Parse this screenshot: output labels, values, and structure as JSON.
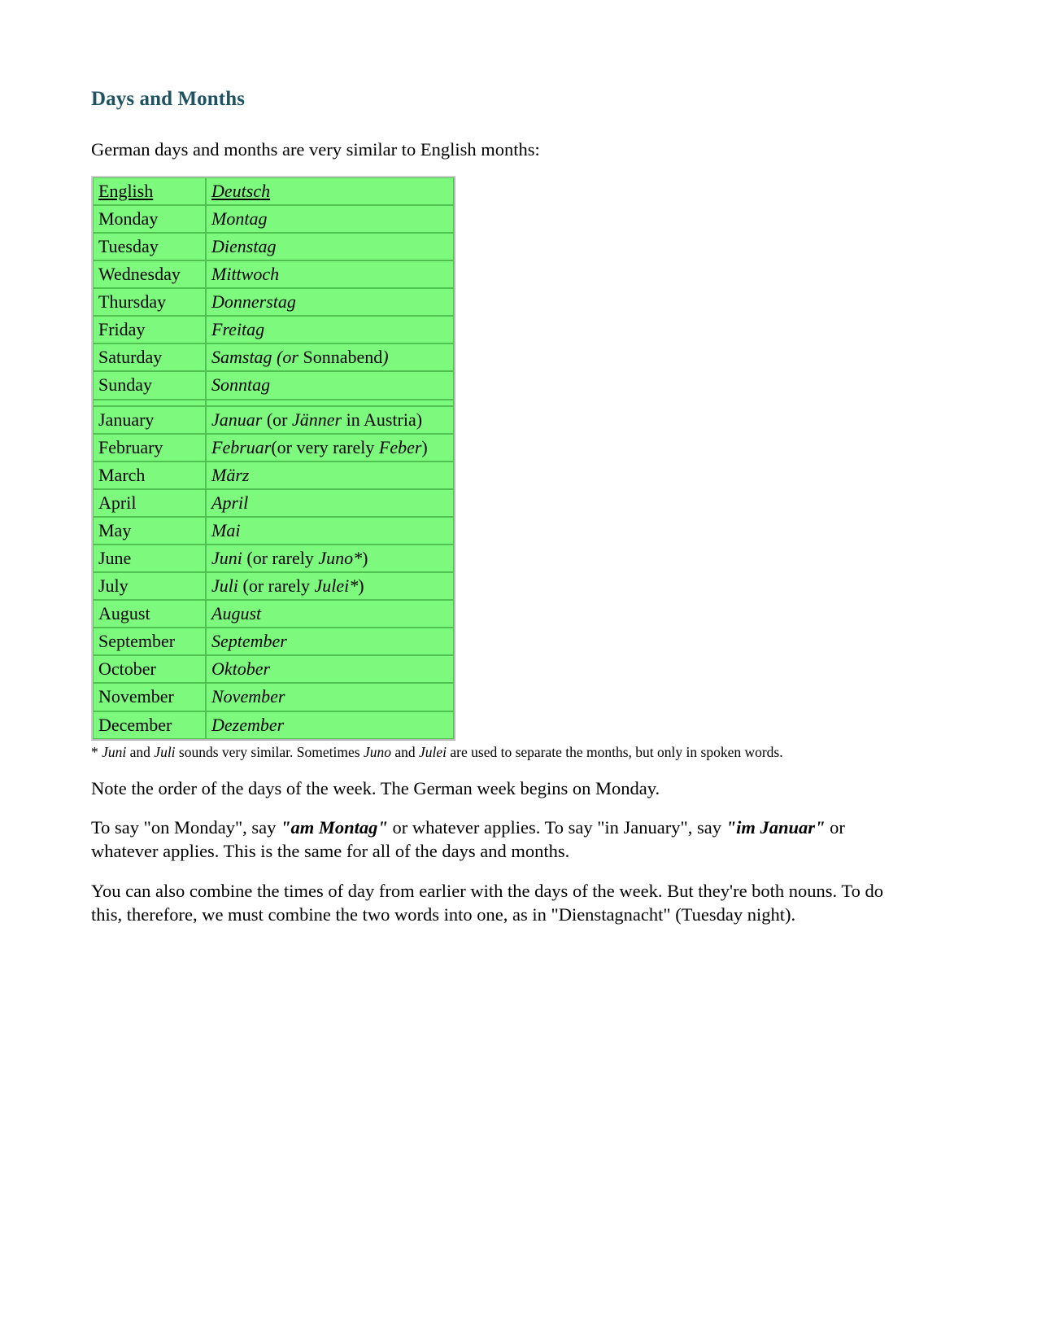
{
  "document": {
    "title": "Days and Months",
    "intro": "German days and months are very similar to English months:"
  },
  "table": {
    "headers": {
      "english": "English",
      "deutsch": "Deutsch"
    },
    "days": [
      {
        "english": "Monday",
        "de_main": "Montag",
        "de_mid": "",
        "de_tail": "",
        "de_end": ""
      },
      {
        "english": "Tuesday",
        "de_main": "Dienstag",
        "de_mid": "",
        "de_tail": "",
        "de_end": ""
      },
      {
        "english": "Wednesday",
        "de_main": "Mittwoch",
        "de_mid": "",
        "de_tail": "",
        "de_end": ""
      },
      {
        "english": "Thursday",
        "de_main": "Donnerstag",
        "de_mid": "",
        "de_tail": "",
        "de_end": ""
      },
      {
        "english": "Friday",
        "de_main": "Freitag",
        "de_mid": "",
        "de_tail": "",
        "de_end": ""
      },
      {
        "english": "Saturday",
        "de_main": "Samstag (or",
        "de_mid": " Sonnabend",
        "de_tail": ")",
        "de_end": ""
      },
      {
        "english": "Sunday",
        "de_main": "Sonntag",
        "de_mid": "",
        "de_tail": "",
        "de_end": ""
      }
    ],
    "months": [
      {
        "english": "January",
        "de_main": "Januar",
        "de_mid": " (or ",
        "de_tail": "Jänner",
        "de_end": " in Austria)"
      },
      {
        "english": "February",
        "de_main": "Februar",
        "de_mid": "(or very rarely ",
        "de_tail": "Feber",
        "de_end": ")"
      },
      {
        "english": "March",
        "de_main": "März",
        "de_mid": "",
        "de_tail": "",
        "de_end": ""
      },
      {
        "english": "April",
        "de_main": "April",
        "de_mid": "",
        "de_tail": "",
        "de_end": ""
      },
      {
        "english": "May",
        "de_main": "Mai",
        "de_mid": "",
        "de_tail": "",
        "de_end": ""
      },
      {
        "english": "June",
        "de_main": "Juni",
        "de_mid": " (or rarely ",
        "de_tail": "Juno*",
        "de_end": ")"
      },
      {
        "english": "July",
        "de_main": "Juli",
        "de_mid": " (or rarely ",
        "de_tail": "Julei*",
        "de_end": ")"
      },
      {
        "english": "August",
        "de_main": "August",
        "de_mid": "",
        "de_tail": "",
        "de_end": ""
      },
      {
        "english": "September",
        "de_main": "September",
        "de_mid": "",
        "de_tail": "",
        "de_end": ""
      },
      {
        "english": "October",
        "de_main": "Oktober",
        "de_mid": "",
        "de_tail": "",
        "de_end": ""
      },
      {
        "english": "November",
        "de_main": "November",
        "de_mid": "",
        "de_tail": "",
        "de_end": ""
      },
      {
        "english": "December",
        "de_main": "Dezember",
        "de_mid": "",
        "de_tail": "",
        "de_end": ""
      }
    ]
  },
  "footnote": {
    "marker": "* ",
    "word1": "Juni",
    "seg1": " and ",
    "word2": "Juli",
    "seg2": " sounds very similar. Sometimes ",
    "word3": "Juno",
    "seg3": " and ",
    "word4": "Julei",
    "seg4": " are used to separate the months, but only in spoken words."
  },
  "paragraphs": {
    "note_order": "Note the order of the days of the week. The German week begins on Monday.",
    "to_say": {
      "part1": "To say \"on Monday\", say ",
      "emph1": "\"am Montag\"",
      "part2": " or whatever applies. To say \"in January\", say ",
      "emph2": "\"im Januar\"",
      "part3": " or whatever applies. This is the same for all of the days and months."
    },
    "combine": "You can also combine the times of day from earlier with the days of the week. But they're both nouns. To do this, therefore, we must combine the two words into one, as in \"Dienstagnacht\" (Tuesday night)."
  },
  "colors": {
    "title": "#1f5362",
    "table_fill": "#7dfa7d",
    "cell_border": "#4fc24f",
    "table_outer_border": "#b7b7b7"
  }
}
